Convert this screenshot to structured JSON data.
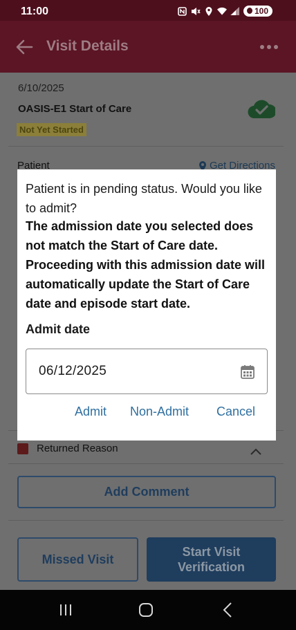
{
  "status_bar": {
    "time": "11:00",
    "battery": "100",
    "icons": [
      "nfc-icon",
      "mute-icon",
      "location-icon",
      "wifi-icon",
      "signal-icon",
      "battery-icon"
    ]
  },
  "app_bar": {
    "title": "Visit Details",
    "icons": [
      "back-arrow-icon",
      "more-options-icon"
    ]
  },
  "visit": {
    "date": "6/10/2025",
    "type": "OASIS-E1 Start of Care",
    "status": "Not Yet Started",
    "sync_icon": "cloud-check-icon"
  },
  "patient": {
    "label": "Patient",
    "directions_label": "Get Directions"
  },
  "returned_reason": {
    "label": "Returned Reason"
  },
  "actions": {
    "add_comment": "Add Comment",
    "missed_visit": "Missed Visit",
    "start_verification_line1": "Start Visit",
    "start_verification_line2": "Verification"
  },
  "dialog": {
    "message": "Patient is in pending status. Would you like to admit?",
    "warning": "The admission date you selected does not match the Start of Care date. Proceeding with this admission date will automatically update the Start of Care date and episode start date.",
    "admit_date_label": "Admit date",
    "admit_date_value": "06/12/2025",
    "buttons": {
      "admit": "Admit",
      "non_admit": "Non-Admit",
      "cancel": "Cancel"
    }
  },
  "colors": {
    "app_bar": "#5b1524",
    "primary_blue": "#1f3d5d",
    "dialog_action": "#2f6fa0",
    "success_green": "#2e7d32"
  }
}
